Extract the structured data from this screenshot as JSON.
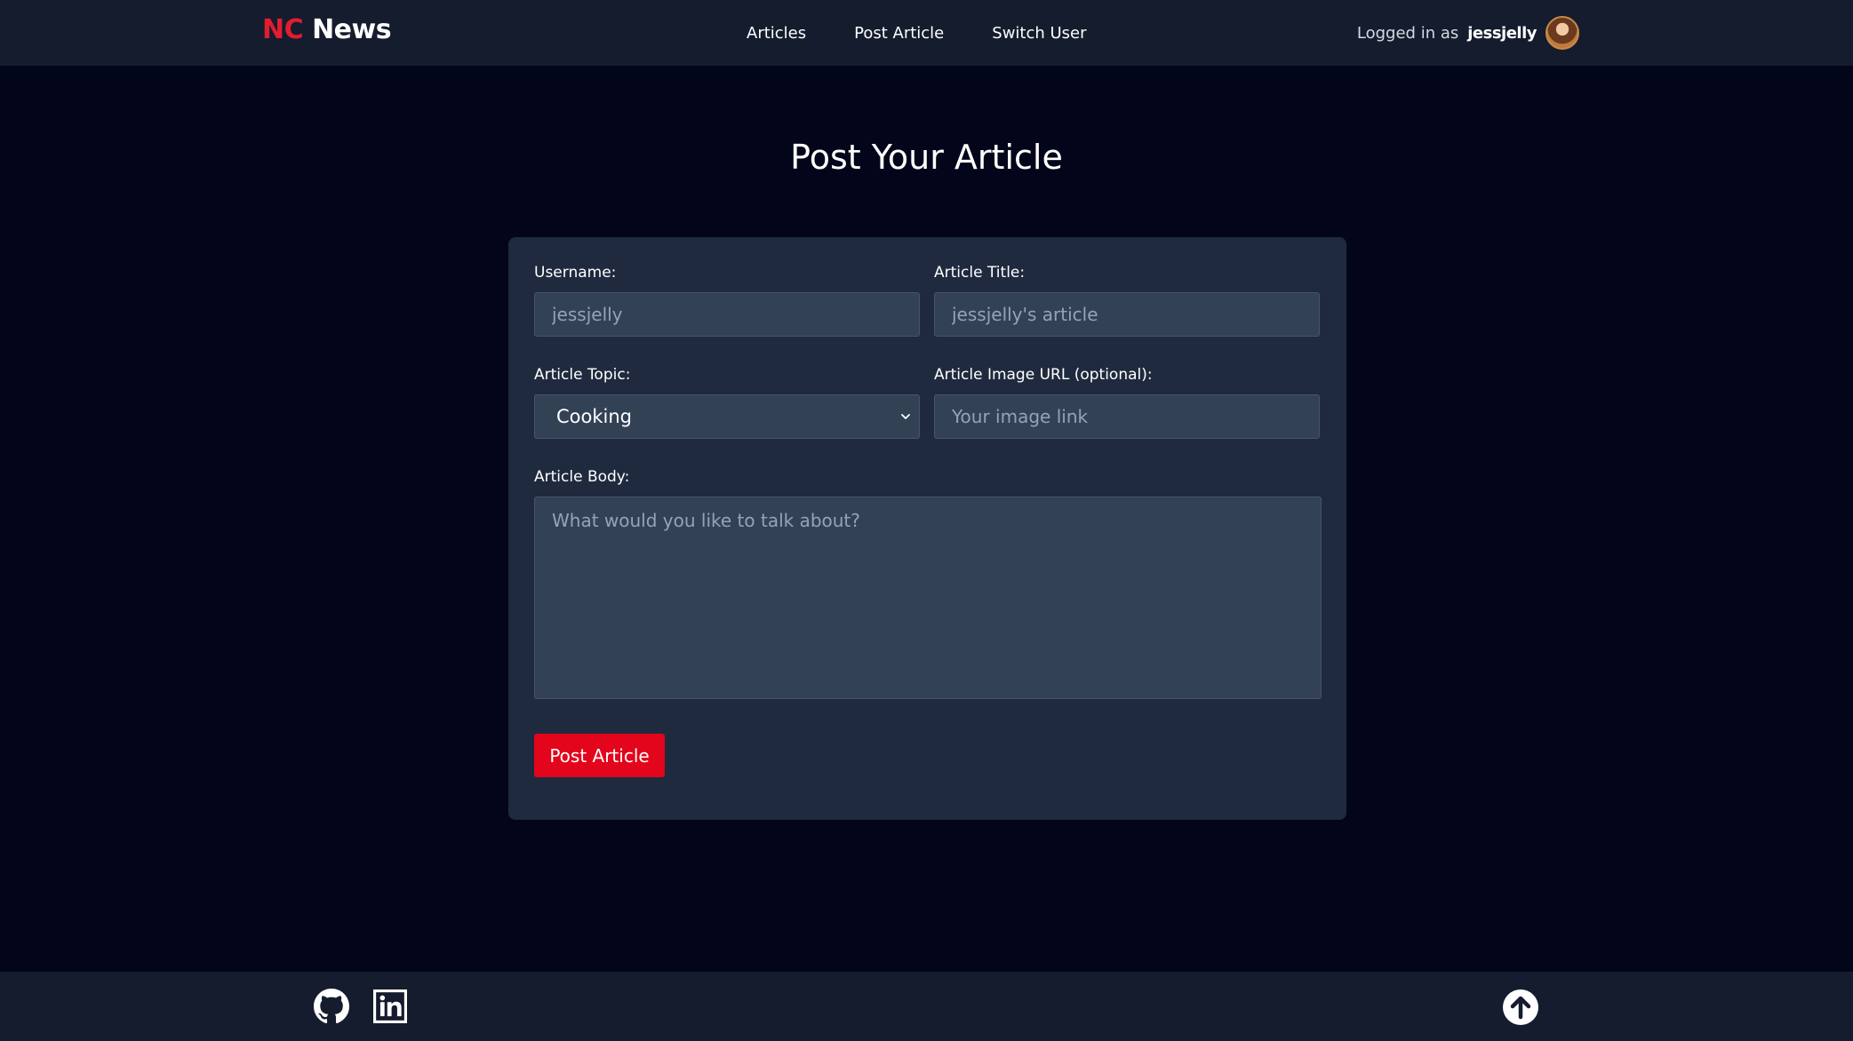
{
  "header": {
    "logo_nc": "NC",
    "logo_news": "News",
    "nav": [
      "Articles",
      "Post Article",
      "Switch User"
    ],
    "logged_in_label": "Logged in as",
    "username": "jessjelly"
  },
  "page": {
    "title": "Post Your Article"
  },
  "form": {
    "username_label": "Username:",
    "username_placeholder": "jessjelly",
    "title_label": "Article Title:",
    "title_placeholder": "jessjelly's article",
    "topic_label": "Article Topic:",
    "topic_selected": "Cooking",
    "image_label": "Article Image URL (optional):",
    "image_placeholder": "Your image link",
    "body_label": "Article Body:",
    "body_placeholder": "What would you like to talk about?",
    "submit_label": "Post Article"
  },
  "footer": {
    "icons": [
      "github-icon",
      "linkedin-icon",
      "scroll-to-top-icon"
    ]
  },
  "colors": {
    "background": "#03061a",
    "bar": "#141c2e",
    "card": "#1f2a3e",
    "input": "#334155",
    "accent_red": "#e3051b",
    "logo_red": "#e11d2e"
  }
}
